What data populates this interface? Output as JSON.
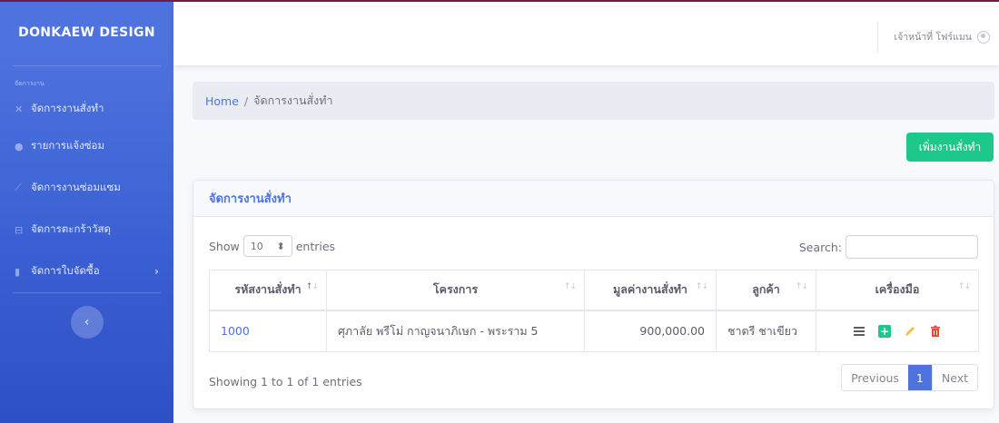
{
  "sidebar": {
    "brand": "DONKAEW DESIGN",
    "heading": "จัดการงาน",
    "items": [
      {
        "icon": "tools-icon",
        "label": "จัดการงานสั่งทำ"
      },
      {
        "icon": "comment-icon",
        "label": "รายการแจ้งซ่อม"
      },
      {
        "icon": "wrench-icon",
        "label": "จัดการงานซ่อมแซม"
      },
      {
        "icon": "basket-icon",
        "label": "จัดการตะกร้าวัสดุ"
      },
      {
        "icon": "file-icon",
        "label": "จัดการใบจัดซื้อ"
      }
    ],
    "toggle_icon": "chevron-left-icon"
  },
  "topbar": {
    "user_label": "เจ้าหน้าที่ โฟร์แมน",
    "user_icon": "user-circle-icon"
  },
  "breadcrumb": {
    "home": "Home",
    "separator": "/",
    "current": "จัดการงานสั่งทำ"
  },
  "add_button": "เพิ่มงานสั่งทำ",
  "card": {
    "title": "จัดการงานสั่งทำ",
    "show_label": "Show",
    "page_length": "10",
    "entries_label": "entries",
    "search_label": "Search:",
    "search_value": "",
    "columns": [
      "รหัสงานสั่งทำ",
      "โครงการ",
      "มูลค่างานสั่งทำ",
      "ลูกค้า",
      "เครื่องมือ"
    ],
    "rows": [
      {
        "code": "1000",
        "project": "ศุภาลัย พรีโม่ กาญจนาภิเษก - พระราม 5",
        "value": "900,000.00",
        "customer": "ชาตรี ชาเขียว"
      }
    ],
    "info": "Showing 1 to 1 of 1 entries",
    "pagination": {
      "previous": "Previous",
      "page": "1",
      "next": "Next"
    }
  },
  "colors": {
    "sidebar": "#4e73df",
    "primary": "#4e73df",
    "success": "#1cc88a",
    "warning": "#f6c23e",
    "danger": "#e74a3b"
  }
}
